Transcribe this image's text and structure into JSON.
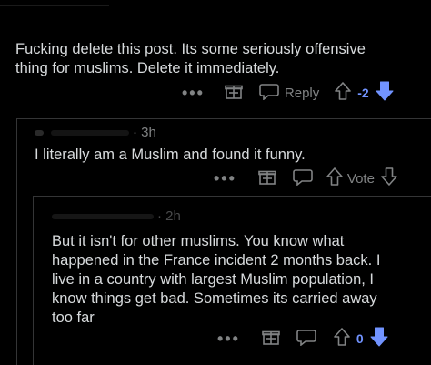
{
  "comment1": {
    "text_line1": "Fucking delete this post. Its some seriously offensive",
    "text_line2": "thing for muslims. Delete it immediately.",
    "actions": {
      "more": "•••",
      "reply": "Reply",
      "score": "-2"
    },
    "colors": {
      "downvote_active": "#7193ff"
    }
  },
  "comment2": {
    "time": "· 3h",
    "text": "I literally am a Muslim and found it funny.",
    "actions": {
      "more": "•••",
      "vote": "Vote"
    }
  },
  "comment3": {
    "time": "· 2h",
    "text_lines": [
      "But it isn't for other muslims. You know what",
      "happened   in the France incident 2 months back. I",
      "live in a country with largest Muslim population, I",
      "know things get bad. Sometimes its carried away",
      "too far"
    ],
    "actions": {
      "more": "•••",
      "score": "0"
    }
  }
}
